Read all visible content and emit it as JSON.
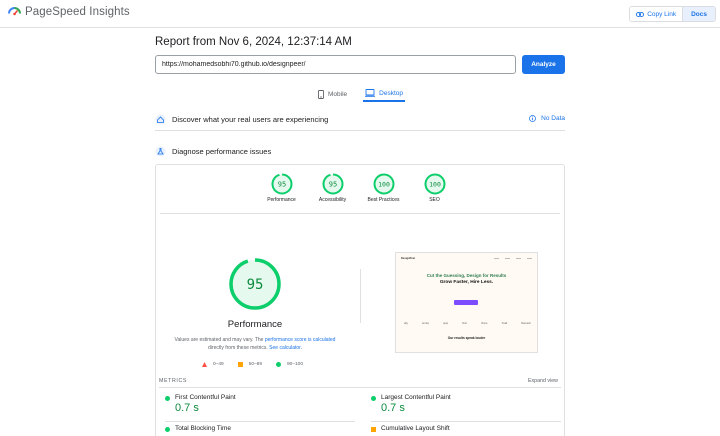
{
  "app": {
    "name": "PageSpeed Insights"
  },
  "topbar": {
    "copy_link": "Copy Link",
    "docs": "Docs"
  },
  "report": {
    "title": "Report from Nov 6, 2024, 12:37:14 AM"
  },
  "search": {
    "url": "https://mohamedsobhi70.github.io/designpeer/",
    "analyze": "Analyze"
  },
  "tabs": [
    {
      "label": "Mobile",
      "active": false
    },
    {
      "label": "Desktop",
      "active": true
    }
  ],
  "crux": {
    "title": "Discover what your real users are experiencing",
    "no_data": "No Data"
  },
  "diagnose": {
    "title": "Diagnose performance issues"
  },
  "scores": [
    {
      "label": "Performance",
      "value": "95",
      "score": 0.95
    },
    {
      "label": "Accessibility",
      "value": "95",
      "score": 0.95
    },
    {
      "label": "Best Practices",
      "value": "100",
      "score": 1.0
    },
    {
      "label": "SEO",
      "value": "100",
      "score": 1.0
    }
  ],
  "main_gauge": {
    "value": "95",
    "score": 0.95,
    "label": "Performance"
  },
  "note": {
    "part1": "Values are estimated and may vary. The ",
    "link1": "performance score is calculated",
    "part2": "directly from these metrics. ",
    "link2": "See calculator."
  },
  "legend": {
    "fail": "0–49",
    "average": "50–89",
    "pass": "90–100"
  },
  "thumbnail": {
    "logo": "DesignPeer",
    "headline": "Cut the Guessing, Design for Results",
    "sub": "Grow Faster, Hire Less.",
    "logos": [
      "ally",
      "Acuity",
      "quiq",
      "hirst",
      "rhone",
      "Xcall",
      "Ramesh"
    ],
    "bottom": "Our results speak louder"
  },
  "metrics": {
    "header": "METRICS",
    "expand": "Expand view",
    "items": [
      {
        "name": "First Contentful Paint",
        "value": "0.7 s"
      },
      {
        "name": "Largest Contentful Paint",
        "value": "0.7 s"
      },
      {
        "name": "Total Blocking Time",
        "value": ""
      },
      {
        "name": "Cumulative Layout Shift",
        "value": ""
      }
    ]
  },
  "colors": {
    "pass": "#0cce6b",
    "pass_text": "#0c8a3e",
    "average": "#ffa400",
    "fail": "#ff4e42",
    "accent": "#1a73e8"
  }
}
